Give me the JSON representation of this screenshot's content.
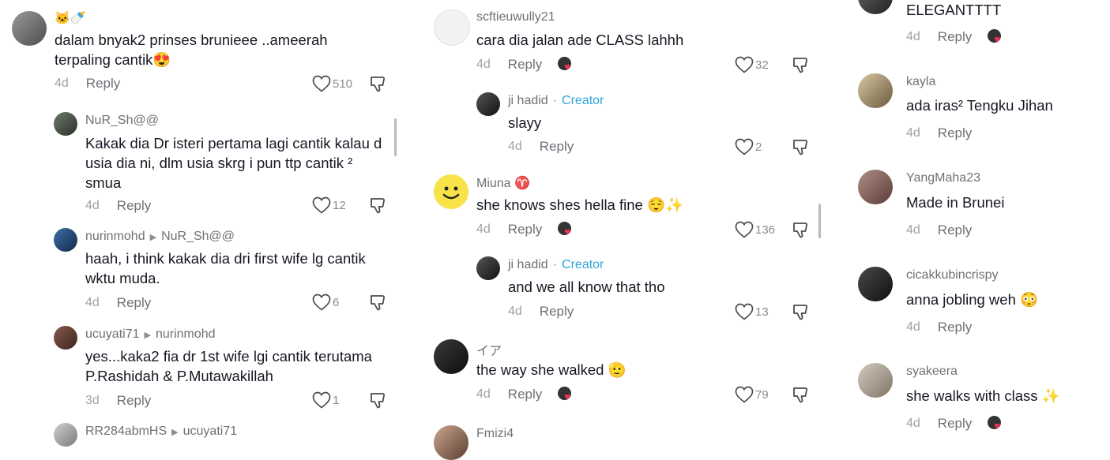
{
  "col1": {
    "comments": [
      {
        "username": "🐱🍼",
        "text": "dalam bnyak2 prinses brunieee ..ameerah terpaling cantik😍",
        "time": "4d",
        "reply": "Reply",
        "likes": "510"
      },
      {
        "username": "NuR_Sh@@",
        "text": "Kakak dia Dr isteri pertama lagi cantik kalau d usia dia ni, dlm usia skrg i pun ttp cantik ² smua",
        "time": "4d",
        "reply": "Reply",
        "likes": "12"
      },
      {
        "username": "nurinmohd",
        "reply_to": "NuR_Sh@@",
        "text": "haah, i think kakak dia dri first wife lg cantik wktu muda.",
        "time": "4d",
        "reply": "Reply",
        "likes": "6"
      },
      {
        "username": "ucuyati71",
        "reply_to": "nurinmohd",
        "text": "yes...kaka2 fia dr 1st wife lgi cantik terutama P.Rashidah & P.Mutawakillah",
        "time": "3d",
        "reply": "Reply",
        "likes": "1"
      },
      {
        "username": "RR284abmHS",
        "reply_to": "ucuyati71"
      }
    ]
  },
  "col2": {
    "comments": [
      {
        "username": "scftieuwully21",
        "text": "cara dia jalan ade CLASS lahhh",
        "time": "4d",
        "reply": "Reply",
        "likes": "32"
      },
      {
        "username": "ji hadid",
        "badge": "Creator",
        "sep": "·",
        "text": "slayy",
        "time": "4d",
        "reply": "Reply",
        "likes": "2"
      },
      {
        "username": "Miuna ♈",
        "text": "she knows shes hella fine 😌✨",
        "time": "4d",
        "reply": "Reply",
        "likes": "136"
      },
      {
        "username": "ji hadid",
        "badge": "Creator",
        "sep": "·",
        "text": "and we all know that tho",
        "time": "4d",
        "reply": "Reply",
        "likes": "13"
      },
      {
        "username": "イア",
        "text": "the way she walked 🫡",
        "time": "4d",
        "reply": "Reply",
        "likes": "79"
      },
      {
        "username": "Fmizi4"
      }
    ]
  },
  "col3": {
    "comments": [
      {
        "text": "ELEGANTTTT",
        "time": "4d",
        "reply": "Reply"
      },
      {
        "username": "kayla",
        "text": "ada iras² Tengku Jihan",
        "time": "4d",
        "reply": "Reply"
      },
      {
        "username": "YangMaha23",
        "text": "Made in Brunei",
        "time": "4d",
        "reply": "Reply"
      },
      {
        "username": "cicakkubincrispy",
        "text": "anna jobling weh 😳",
        "time": "4d",
        "reply": "Reply"
      },
      {
        "username": "syakeera",
        "text": "she walks with class ✨",
        "time": "4d",
        "reply": "Reply"
      }
    ]
  }
}
